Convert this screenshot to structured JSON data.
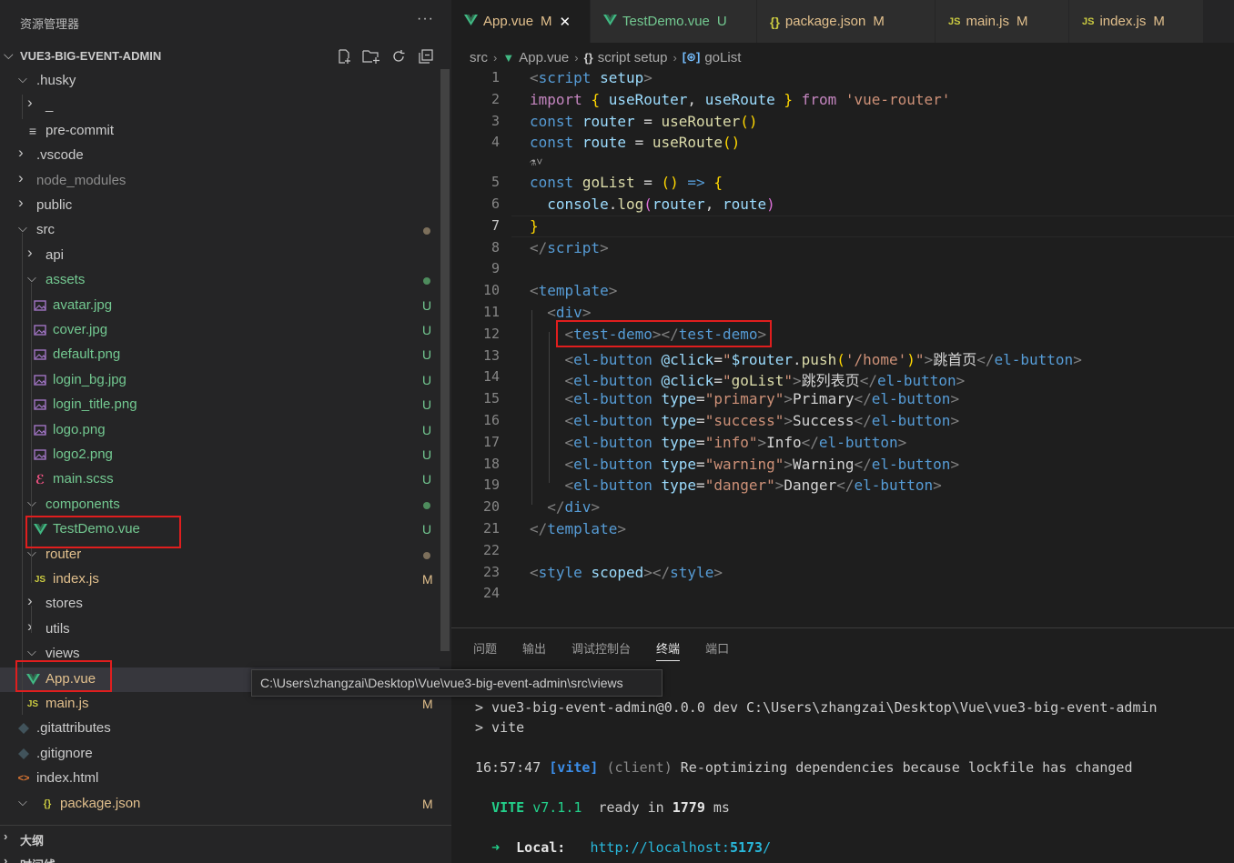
{
  "explorer": {
    "title": "资源管理器",
    "more_label": "···",
    "project": "VUE3-BIG-EVENT-ADMIN",
    "tree": [
      {
        "label": ".husky",
        "kind": "folder-open",
        "depth": 1
      },
      {
        "label": "_",
        "kind": "folder",
        "depth": 2
      },
      {
        "label": "pre-commit",
        "kind": "file-lines",
        "depth": 2
      },
      {
        "label": ".vscode",
        "kind": "folder",
        "depth": 1
      },
      {
        "label": "node_modules",
        "kind": "folder",
        "depth": 1,
        "dim": true
      },
      {
        "label": "public",
        "kind": "folder",
        "depth": 1
      },
      {
        "label": "src",
        "kind": "folder-open",
        "depth": 1,
        "status": "dot-gray"
      },
      {
        "label": "api",
        "kind": "folder",
        "depth": 2
      },
      {
        "label": "assets",
        "kind": "folder-open",
        "depth": 2,
        "status": "dot-green",
        "color": "untracked"
      },
      {
        "label": "avatar.jpg",
        "kind": "image",
        "depth": 3,
        "badge": "U"
      },
      {
        "label": "cover.jpg",
        "kind": "image",
        "depth": 3,
        "badge": "U"
      },
      {
        "label": "default.png",
        "kind": "image",
        "depth": 3,
        "badge": "U"
      },
      {
        "label": "login_bg.jpg",
        "kind": "image",
        "depth": 3,
        "badge": "U"
      },
      {
        "label": "login_title.png",
        "kind": "image",
        "depth": 3,
        "badge": "U"
      },
      {
        "label": "logo.png",
        "kind": "image",
        "depth": 3,
        "badge": "U"
      },
      {
        "label": "logo2.png",
        "kind": "image",
        "depth": 3,
        "badge": "U"
      },
      {
        "label": "main.scss",
        "kind": "scss",
        "depth": 3,
        "badge": "U"
      },
      {
        "label": "components",
        "kind": "folder-open",
        "depth": 2,
        "status": "dot-green",
        "color": "untracked"
      },
      {
        "label": "TestDemo.vue",
        "kind": "vue",
        "depth": 3,
        "badge": "U"
      },
      {
        "label": "router",
        "kind": "folder-open",
        "depth": 2,
        "status": "dot-gray",
        "color": "mod"
      },
      {
        "label": "index.js",
        "kind": "js",
        "depth": 3,
        "badge": "M"
      },
      {
        "label": "stores",
        "kind": "folder",
        "depth": 2
      },
      {
        "label": "utils",
        "kind": "folder",
        "depth": 2
      },
      {
        "label": "views",
        "kind": "folder-open",
        "depth": 2
      },
      {
        "label": "App.vue",
        "kind": "vue",
        "depth": 2,
        "badge": "",
        "selected": true,
        "color": "mod"
      },
      {
        "label": "main.js",
        "kind": "js",
        "depth": 2,
        "badge": "M"
      },
      {
        "label": ".gitattributes",
        "kind": "git",
        "depth": 1
      },
      {
        "label": ".gitignore",
        "kind": "git",
        "depth": 1
      },
      {
        "label": "index.html",
        "kind": "html",
        "depth": 1
      },
      {
        "label": "package.json",
        "kind": "json",
        "depth": 1,
        "badge": "M",
        "chev": true
      }
    ],
    "bottom_panels": [
      "大纲",
      "时间线"
    ],
    "tooltip": "C:\\Users\\zhangzai\\Desktop\\Vue\\vue3-big-event-admin\\src\\views"
  },
  "tabs": [
    {
      "label": "App.vue",
      "status": "M",
      "icon": "vue",
      "active": true
    },
    {
      "label": "TestDemo.vue",
      "status": "U",
      "icon": "vue"
    },
    {
      "label": "package.json",
      "status": "M",
      "icon": "json"
    },
    {
      "label": "main.js",
      "status": "M",
      "icon": "js"
    },
    {
      "label": "index.js",
      "status": "M",
      "icon": "js"
    }
  ],
  "breadcrumb": [
    "src",
    "App.vue",
    "script setup",
    "goList"
  ],
  "code": {
    "cursor_line": 7,
    "lines": [
      {
        "n": "1",
        "html": "<span class='tk-punc'>&lt;</span><span class='tk-tag'>script</span> <span class='tk-var'>setup</span><span class='tk-punc'>&gt;</span>"
      },
      {
        "n": "2",
        "html": "<span class='tk-kw'>import</span> <span class='tk-brace'>{</span> <span class='tk-var'>useRouter</span>, <span class='tk-var'>useRoute</span> <span class='tk-brace'>}</span> <span class='tk-kw'>from</span> <span class='tk-str'>'vue-router'</span>"
      },
      {
        "n": "3",
        "html": "<span class='tk-storage'>const</span> <span class='tk-var'>router</span> = <span class='tk-fn'>useRouter</span><span class='tk-brace'>()</span>"
      },
      {
        "n": "4",
        "html": "<span class='tk-storage'>const</span> <span class='tk-var'>route</span> = <span class='tk-fn'>useRoute</span><span class='tk-brace'>()</span>"
      },
      {
        "n": "",
        "lens": "⚗˅"
      },
      {
        "n": "5",
        "html": "<span class='tk-storage'>const</span> <span class='tk-fn'>goList</span> = <span class='tk-brace'>()</span> <span class='tk-storage'>=&gt;</span> <span class='tk-brace'>{</span>"
      },
      {
        "n": "6",
        "html": "  <span class='tk-var'>console</span>.<span class='tk-fn'>log</span><span class='tk-paren'>(</span><span class='tk-var'>router</span>, <span class='tk-var'>route</span><span class='tk-paren'>)</span>"
      },
      {
        "n": "7",
        "html": "<span class='tk-brace'>}</span>"
      },
      {
        "n": "8",
        "html": "<span class='tk-punc'>&lt;/</span><span class='tk-tag'>script</span><span class='tk-punc'>&gt;</span>"
      },
      {
        "n": "9",
        "html": ""
      },
      {
        "n": "10",
        "html": "<span class='tk-punc'>&lt;</span><span class='tk-tag'>template</span><span class='tk-punc'>&gt;</span>"
      },
      {
        "n": "11",
        "html": "  <span class='tk-punc'>&lt;</span><span class='tk-tag'>div</span><span class='tk-punc'>&gt;</span>"
      },
      {
        "n": "12",
        "html": "    <span class='tk-punc'>&lt;</span><span class='tk-tag'>test-demo</span><span class='tk-punc'>&gt;&lt;/</span><span class='tk-tag'>test-demo</span><span class='tk-punc'>&gt;</span>"
      },
      {
        "n": "13",
        "html": "    <span class='tk-punc'>&lt;</span><span class='tk-tag'>el-button</span> <span class='tk-var'>@click</span>=<span class='tk-str'>\"</span><span class='tk-var'>$router</span>.<span class='tk-fn'>push</span><span class='tk-brace'>(</span><span class='tk-str'>'/home'</span><span class='tk-brace'>)</span><span class='tk-str'>\"</span><span class='tk-punc'>&gt;</span>跳首页<span class='tk-punc'>&lt;/</span><span class='tk-tag'>el-button</span><span class='tk-punc'>&gt;</span>"
      },
      {
        "n": "14",
        "html": "    <span class='tk-punc'>&lt;</span><span class='tk-tag'>el-button</span> <span class='tk-var'>@click</span>=<span class='tk-str'>\"</span><span class='tk-fn'>goList</span><span class='tk-str'>\"</span><span class='tk-punc'>&gt;</span>跳列表页<span class='tk-punc'>&lt;/</span><span class='tk-tag'>el-button</span><span class='tk-punc'>&gt;</span>"
      },
      {
        "n": "15",
        "html": "    <span class='tk-punc'>&lt;</span><span class='tk-tag'>el-button</span> <span class='tk-var'>type</span>=<span class='tk-str'>\"primary\"</span><span class='tk-punc'>&gt;</span>Primary<span class='tk-punc'>&lt;/</span><span class='tk-tag'>el-button</span><span class='tk-punc'>&gt;</span>"
      },
      {
        "n": "16",
        "html": "    <span class='tk-punc'>&lt;</span><span class='tk-tag'>el-button</span> <span class='tk-var'>type</span>=<span class='tk-str'>\"success\"</span><span class='tk-punc'>&gt;</span>Success<span class='tk-punc'>&lt;/</span><span class='tk-tag'>el-button</span><span class='tk-punc'>&gt;</span>"
      },
      {
        "n": "17",
        "html": "    <span class='tk-punc'>&lt;</span><span class='tk-tag'>el-button</span> <span class='tk-var'>type</span>=<span class='tk-str'>\"info\"</span><span class='tk-punc'>&gt;</span>Info<span class='tk-punc'>&lt;/</span><span class='tk-tag'>el-button</span><span class='tk-punc'>&gt;</span>"
      },
      {
        "n": "18",
        "html": "    <span class='tk-punc'>&lt;</span><span class='tk-tag'>el-button</span> <span class='tk-var'>type</span>=<span class='tk-str'>\"warning\"</span><span class='tk-punc'>&gt;</span>Warning<span class='tk-punc'>&lt;/</span><span class='tk-tag'>el-button</span><span class='tk-punc'>&gt;</span>"
      },
      {
        "n": "19",
        "html": "    <span class='tk-punc'>&lt;</span><span class='tk-tag'>el-button</span> <span class='tk-var'>type</span>=<span class='tk-str'>\"danger\"</span><span class='tk-punc'>&gt;</span>Danger<span class='tk-punc'>&lt;/</span><span class='tk-tag'>el-button</span><span class='tk-punc'>&gt;</span>"
      },
      {
        "n": "20",
        "html": "  <span class='tk-punc'>&lt;/</span><span class='tk-tag'>div</span><span class='tk-punc'>&gt;</span>"
      },
      {
        "n": "21",
        "html": "<span class='tk-punc'>&lt;/</span><span class='tk-tag'>template</span><span class='tk-punc'>&gt;</span>"
      },
      {
        "n": "22",
        "html": ""
      },
      {
        "n": "23",
        "html": "<span class='tk-punc'>&lt;</span><span class='tk-tag'>style</span> <span class='tk-var'>scoped</span><span class='tk-punc'>&gt;&lt;/</span><span class='tk-tag'>style</span><span class='tk-punc'>&gt;</span>"
      },
      {
        "n": "24",
        "html": ""
      }
    ]
  },
  "panel": {
    "tabs": [
      "问题",
      "输出",
      "调试控制台",
      "终端",
      "端口"
    ],
    "active_tab": "终端",
    "terminal": {
      "cmd1": "> vue3-big-event-admin@0.0.0 dev C:\\Users\\zhangzai\\Desktop\\Vue\\vue3-big-event-admin",
      "cmd2": "> vite",
      "time": "16:57:47",
      "tag": "[vite]",
      "client": "(client)",
      "msg": "Re-optimizing dependencies because lockfile has changed",
      "vite_label": "VITE",
      "vite_version": "v7.1.1",
      "ready_text": "ready in",
      "ready_ms": "1779",
      "ms_label": "ms",
      "arrow": "➜",
      "local_label": "Local:",
      "local_url_prefix": "http://localhost:",
      "local_port": "5173",
      "local_url_suffix": "/"
    }
  },
  "colors": {
    "untracked": "#73c991",
    "modified": "#e2c08d",
    "highlight_box": "#e01e1e",
    "vue_icon": "#41b883"
  }
}
